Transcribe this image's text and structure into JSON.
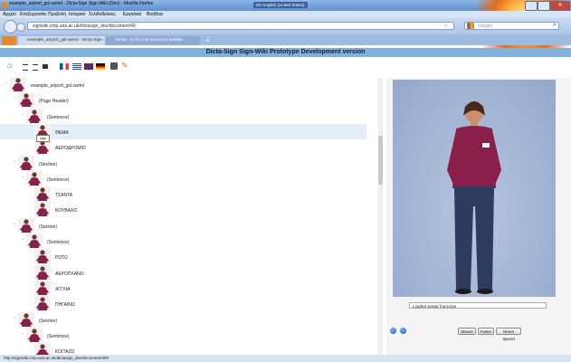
{
  "window": {
    "title": "example_airport_gsl.swiml - Dicta-Sign Sign-Wiki (Dev) - Mozilla Firefox",
    "language_indicator": "EN English (United States)"
  },
  "menu": {
    "items": [
      "Αρχείο",
      "Επεξεργασία",
      "Προβολή",
      "Ιστορικό",
      "Σελιδοδείκτες",
      "Εργαλεία",
      "Βοήθεια"
    ]
  },
  "navbar": {
    "url": "signwiki.cmp.uea.ac.uk/dictasign_dev/document/49",
    "search_placeholder": "Google"
  },
  "tabs": [
    {
      "label": "example_airport_gsl.swiml - Dicta-Sign ...",
      "active": true
    },
    {
      "label": "Gmail - to tfl.1 me sva ivoro katallia ...",
      "active": false
    }
  ],
  "page": {
    "header": "Dicta-Sign Sign-Wiki Prototype Development version"
  },
  "toolbar": {
    "icons": [
      "home-icon",
      "list-icon",
      "list-icon",
      "list-icon",
      "flag-fr-icon",
      "flag-gr-icon",
      "flag-uk-icon",
      "flag-de-icon",
      "export-icon",
      "edit-icon"
    ]
  },
  "tree": {
    "nodes": [
      {
        "label": "example_airport_gsl.swiml",
        "depth": 0,
        "expander": "−"
      },
      {
        "label": "(Page Header)",
        "depth": 1,
        "expander": "−"
      },
      {
        "label": "(Sentence)",
        "depth": 2,
        "expander": "−"
      },
      {
        "label": "ΘΕΜΑ",
        "depth": 3,
        "expander": "",
        "selected": true
      },
      {
        "label": "ΑΕΡΟΔΡΟΜΙΟ",
        "depth": 3,
        "expander": ""
      },
      {
        "label": "(Section)",
        "depth": 1,
        "expander": "−"
      },
      {
        "label": "(Sentence)",
        "depth": 2,
        "expander": "−"
      },
      {
        "label": "ΤΣΑΝΤΑ",
        "depth": 3,
        "expander": ""
      },
      {
        "label": "ΚΟΥΒΑΛΩ",
        "depth": 3,
        "expander": ""
      },
      {
        "label": "(Section)",
        "depth": 1,
        "expander": "−"
      },
      {
        "label": "(Sentence)",
        "depth": 2,
        "expander": "−"
      },
      {
        "label": "ΡΩΤΩ",
        "depth": 3,
        "expander": ""
      },
      {
        "label": "ΑΕΡΟΠΛΑΝΟ",
        "depth": 3,
        "expander": ""
      },
      {
        "label": "ΑΓΓΛΙΑ",
        "depth": 3,
        "expander": ""
      },
      {
        "label": "ΠΗΓΑΙΝΩ",
        "depth": 3,
        "expander": ""
      },
      {
        "label": "(Section)",
        "depth": 1,
        "expander": "−"
      },
      {
        "label": "(Sentence)",
        "depth": 2,
        "expander": "−"
      },
      {
        "label": "ΚΟΙΤΑΖΩ",
        "depth": 3,
        "expander": ""
      }
    ],
    "tooltip": "sign"
  },
  "player": {
    "status": "Loaded avatar francoise",
    "slower_label": "Slower",
    "faster_label": "Faster",
    "reset_label": "Reset Speed"
  },
  "statusbar": {
    "text": "http://signwiki.cmp.uea.ac.uk/dictasign_dev/document/49#"
  },
  "colors": {
    "header_bar": "#7fb2df",
    "selected_row": "#e4eef9",
    "avatar_bg": "#9eb1d2"
  }
}
